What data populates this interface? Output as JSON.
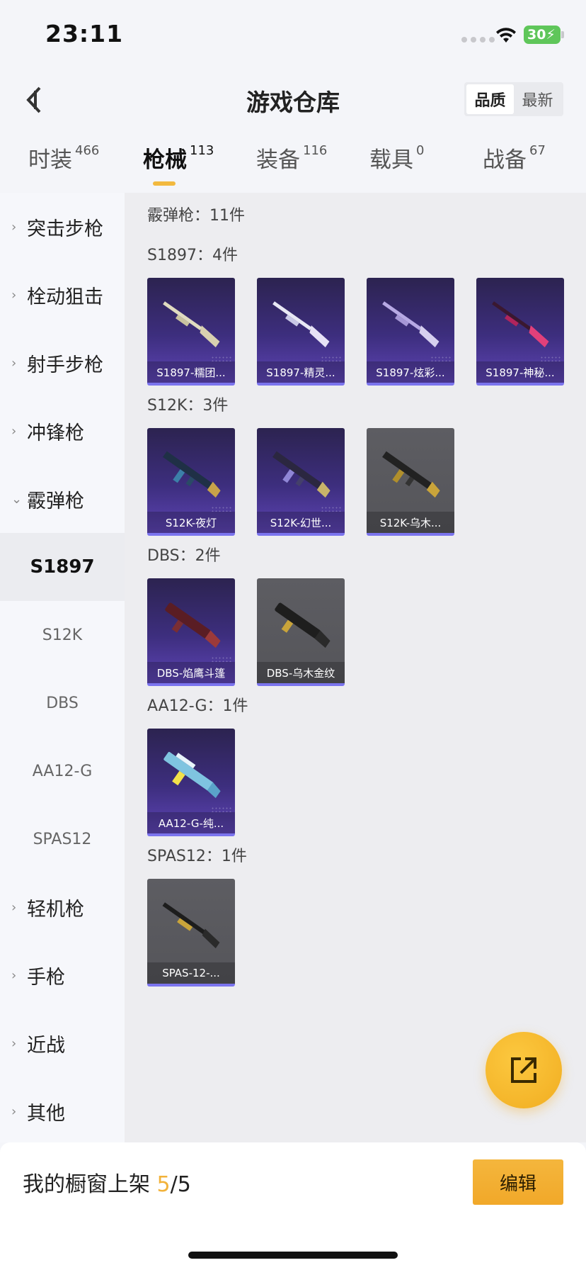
{
  "status": {
    "time": "23:11",
    "battery": "30"
  },
  "header": {
    "title": "游戏仓库",
    "sort_quality": "品质",
    "sort_newest": "最新"
  },
  "tabs": [
    {
      "label": "时装",
      "count": "466"
    },
    {
      "label": "枪械",
      "count": "113"
    },
    {
      "label": "装备",
      "count": "116"
    },
    {
      "label": "载具",
      "count": "0"
    },
    {
      "label": "战备",
      "count": "67"
    }
  ],
  "sidebar": {
    "categories": [
      "突击步枪",
      "栓动狙击",
      "射手步枪",
      "冲锋枪",
      "霰弹枪",
      "轻机枪",
      "手枪",
      "近战",
      "其他"
    ],
    "subitems": [
      "S1897",
      "S12K",
      "DBS",
      "AA12-G",
      "SPAS12"
    ]
  },
  "main": {
    "group_total": "霰弹枪：11件",
    "sections": [
      {
        "title": "S1897：4件",
        "items": [
          "S1897-糯团...",
          "S1897-精灵...",
          "S1897-炫彩...",
          "S1897-神秘..."
        ]
      },
      {
        "title": "S12K：3件",
        "items": [
          "S12K-夜灯",
          "S12K-幻世...",
          "S12K-乌木..."
        ]
      },
      {
        "title": "DBS：2件",
        "items": [
          "DBS-焰鹰斗篷",
          "DBS-乌木金纹"
        ]
      },
      {
        "title": "AA12-G：1件",
        "items": [
          "AA12-G-纯..."
        ]
      },
      {
        "title": "SPAS12：1件",
        "items": [
          "SPAS-12-..."
        ]
      }
    ]
  },
  "bottom": {
    "shelf_label": "我的橱窗上架 ",
    "shelf_count": "5",
    "shelf_total": "/5",
    "edit_label": "编辑"
  },
  "colors": {
    "accent": "#f2b23a",
    "card_purple": "#3d2e7e",
    "card_gray": "#55555a"
  }
}
